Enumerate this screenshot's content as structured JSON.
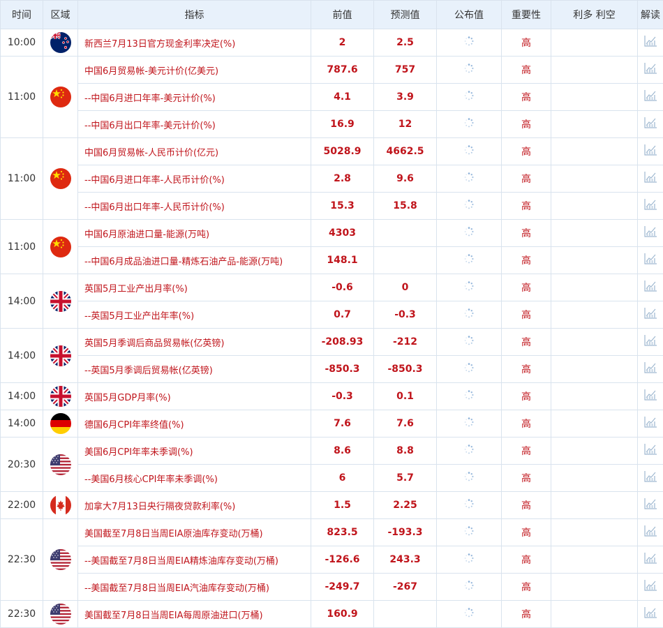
{
  "headers": [
    "时间",
    "区域",
    "指标",
    "前值",
    "预测值",
    "公布值",
    "重要性",
    "利多 利空",
    "解读"
  ],
  "flag_icons": {
    "nz": "new-zealand-flag-icon",
    "cn": "china-flag-icon",
    "gb": "uk-flag-icon",
    "de": "germany-flag-icon",
    "us": "usa-flag-icon",
    "ca": "canada-flag-icon"
  },
  "colors": {
    "accent_red": "#c0141b",
    "header_bg": "#e8f1fb",
    "border": "#d9e3ee"
  },
  "groups": [
    {
      "time": "10:00",
      "flag": "nz",
      "rows": [
        {
          "indicator": "新西兰7月13日官方现金利率决定(%)",
          "prev": "2",
          "forecast": "2.5",
          "actual": "",
          "importance": "高"
        }
      ]
    },
    {
      "time": "11:00",
      "flag": "cn",
      "rows": [
        {
          "indicator": "中国6月贸易帐-美元计价(亿美元)",
          "prev": "787.6",
          "forecast": "757",
          "actual": "",
          "importance": "高"
        },
        {
          "indicator": "--中国6月进口年率-美元计价(%)",
          "prev": "4.1",
          "forecast": "3.9",
          "actual": "",
          "importance": "高"
        },
        {
          "indicator": "--中国6月出口年率-美元计价(%)",
          "prev": "16.9",
          "forecast": "12",
          "actual": "",
          "importance": "高"
        }
      ]
    },
    {
      "time": "11:00",
      "flag": "cn",
      "rows": [
        {
          "indicator": "中国6月贸易帐-人民币计价(亿元)",
          "prev": "5028.9",
          "forecast": "4662.5",
          "actual": "",
          "importance": "高"
        },
        {
          "indicator": "--中国6月进口年率-人民币计价(%)",
          "prev": "2.8",
          "forecast": "9.6",
          "actual": "",
          "importance": "高"
        },
        {
          "indicator": "--中国6月出口年率-人民币计价(%)",
          "prev": "15.3",
          "forecast": "15.8",
          "actual": "",
          "importance": "高"
        }
      ]
    },
    {
      "time": "11:00",
      "flag": "cn",
      "rows": [
        {
          "indicator": "中国6月原油进口量-能源(万吨)",
          "prev": "4303",
          "forecast": "",
          "actual": "",
          "importance": "高"
        },
        {
          "indicator": "--中国6月成品油进口量-精炼石油产品-能源(万吨)",
          "prev": "148.1",
          "forecast": "",
          "actual": "",
          "importance": "高"
        }
      ]
    },
    {
      "time": "14:00",
      "flag": "gb",
      "rows": [
        {
          "indicator": "英国5月工业产出月率(%)",
          "prev": "-0.6",
          "forecast": "0",
          "actual": "",
          "importance": "高"
        },
        {
          "indicator": "--英国5月工业产出年率(%)",
          "prev": "0.7",
          "forecast": "-0.3",
          "actual": "",
          "importance": "高"
        }
      ]
    },
    {
      "time": "14:00",
      "flag": "gb",
      "rows": [
        {
          "indicator": "英国5月季调后商品贸易帐(亿英镑)",
          "prev": "-208.93",
          "forecast": "-212",
          "actual": "",
          "importance": "高"
        },
        {
          "indicator": "--英国5月季调后贸易帐(亿英镑)",
          "prev": "-850.3",
          "forecast": "-850.3",
          "actual": "",
          "importance": "高"
        }
      ]
    },
    {
      "time": "14:00",
      "flag": "gb",
      "rows": [
        {
          "indicator": "英国5月GDP月率(%)",
          "prev": "-0.3",
          "forecast": "0.1",
          "actual": "",
          "importance": "高"
        }
      ]
    },
    {
      "time": "14:00",
      "flag": "de",
      "rows": [
        {
          "indicator": "德国6月CPI年率终值(%)",
          "prev": "7.6",
          "forecast": "7.6",
          "actual": "",
          "importance": "高"
        }
      ]
    },
    {
      "time": "20:30",
      "flag": "us",
      "rows": [
        {
          "indicator": "美国6月CPI年率未季调(%)",
          "prev": "8.6",
          "forecast": "8.8",
          "actual": "",
          "importance": "高"
        },
        {
          "indicator": "--美国6月核心CPI年率未季调(%)",
          "prev": "6",
          "forecast": "5.7",
          "actual": "",
          "importance": "高"
        }
      ]
    },
    {
      "time": "22:00",
      "flag": "ca",
      "rows": [
        {
          "indicator": "加拿大7月13日央行隔夜贷款利率(%)",
          "prev": "1.5",
          "forecast": "2.25",
          "actual": "",
          "importance": "高"
        }
      ]
    },
    {
      "time": "22:30",
      "flag": "us",
      "rows": [
        {
          "indicator": "美国截至7月8日当周EIA原油库存变动(万桶)",
          "prev": "823.5",
          "forecast": "-193.3",
          "actual": "",
          "importance": "高"
        },
        {
          "indicator": "--美国截至7月8日当周EIA精炼油库存变动(万桶)",
          "prev": "-126.6",
          "forecast": "243.3",
          "actual": "",
          "importance": "高"
        },
        {
          "indicator": "--美国截至7月8日当周EIA汽油库存变动(万桶)",
          "prev": "-249.7",
          "forecast": "-267",
          "actual": "",
          "importance": "高"
        }
      ]
    },
    {
      "time": "22:30",
      "flag": "us",
      "rows": [
        {
          "indicator": "美国截至7月8日当周EIA每周原油进口(万桶)",
          "prev": "160.9",
          "forecast": "",
          "actual": "",
          "importance": "高"
        }
      ]
    }
  ]
}
